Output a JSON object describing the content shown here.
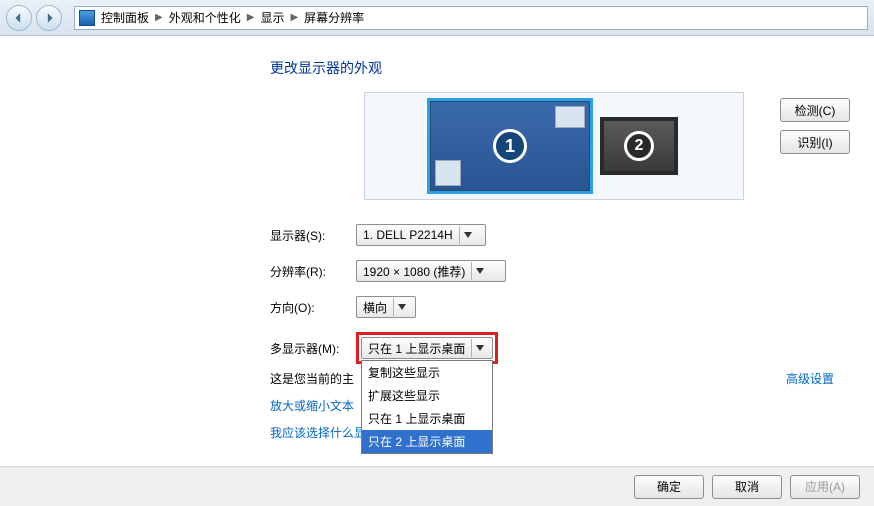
{
  "breadcrumb": {
    "items": [
      "控制面板",
      "外观和个性化",
      "显示",
      "屏幕分辨率"
    ]
  },
  "heading": "更改显示器的外观",
  "monitors": {
    "m1_badge": "1",
    "m2_badge": "2"
  },
  "buttons": {
    "detect": "检测(C)",
    "identify": "识别(I)",
    "ok": "确定",
    "cancel": "取消",
    "apply": "应用(A)"
  },
  "labels": {
    "display": "显示器(S):",
    "resolution": "分辨率(R):",
    "orientation": "方向(O):",
    "multi": "多显示器(M):",
    "primary_prefix": "这是您当前的主"
  },
  "values": {
    "display": "1. DELL P2214H",
    "resolution": "1920 × 1080 (推荐)",
    "orientation": "横向",
    "multi_selected": "只在 1 上显示桌面"
  },
  "multi_options": [
    "复制这些显示",
    "扩展这些显示",
    "只在 1 上显示桌面",
    "只在 2 上显示桌面"
  ],
  "links": {
    "text_size": "放大或缩小文本",
    "which_display": "我应该选择什么显示器设置？",
    "advanced": "高级设置"
  }
}
